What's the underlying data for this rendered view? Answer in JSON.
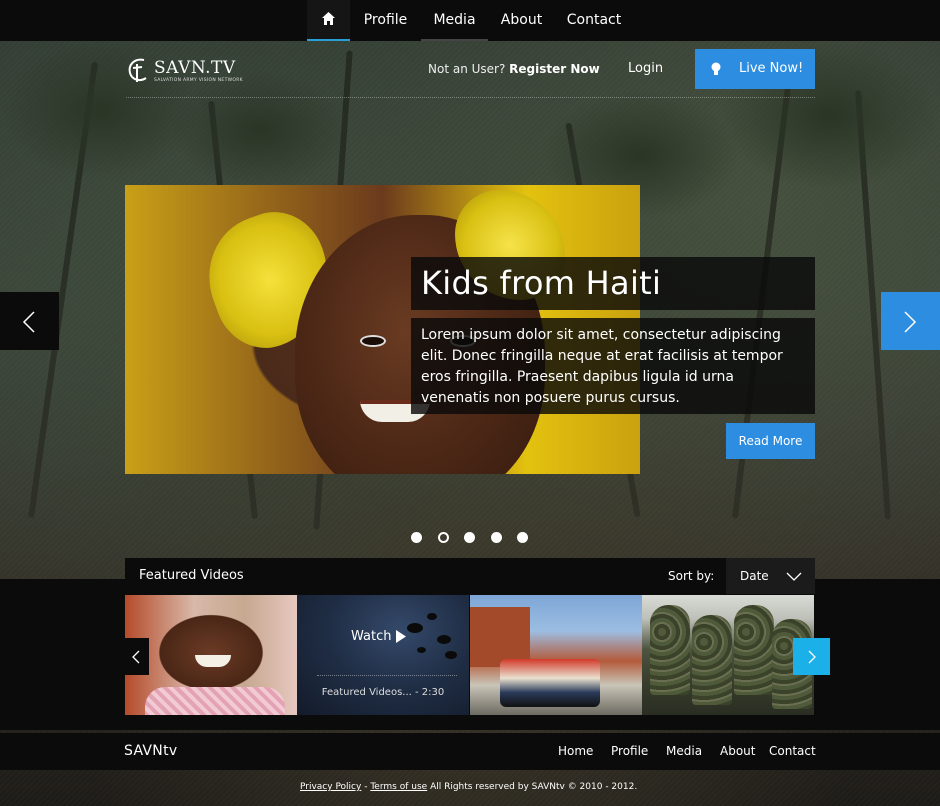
{
  "topnav": {
    "home_icon": "home-icon",
    "items": [
      "Profile",
      "Media",
      "About",
      "Contact"
    ],
    "active": "home"
  },
  "header": {
    "logo_text": "SAVN.TV",
    "logo_tagline": "SALVATION ARMY VISION NETWORK",
    "not_user_text": "Not an User?",
    "register_label": "Register Now",
    "login_label": "Login",
    "live_label": "Live Now!",
    "live_icon": "lightbulb-icon"
  },
  "slider": {
    "title": "Kids from Haiti",
    "body": "Lorem ipsum dolor sit amet, consectetur adipiscing elit. Donec fringilla neque at erat facilisis at tempor eros fringilla. Praesent dapibus ligula id urna venenatis non posuere purus cursus.",
    "read_more": "Read More",
    "dots": 5,
    "active_dot": 1,
    "accent_color": "#2d8de0"
  },
  "featured": {
    "title": "Featured Videos",
    "sort_label": "Sort by:",
    "sort_value": "Date",
    "watch_label": "Watch",
    "video_meta": "Featured Videos... - 2:30",
    "arrow_color": "#1bb0e8"
  },
  "footer": {
    "brand": "SAVNtv",
    "links": [
      "Home",
      "Profile",
      "Media",
      "About",
      "Contact"
    ],
    "privacy": "Privacy Policy",
    "separator": "-",
    "terms": "Terms of use",
    "rights": "All Rights reserved by SAVNtv © 2010 - 2012."
  }
}
